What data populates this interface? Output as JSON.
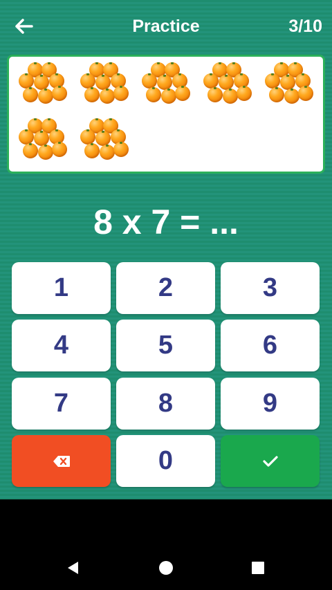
{
  "header": {
    "title": "Practice",
    "progress": "3/10"
  },
  "question": {
    "equation": "8 x 7 = ..."
  },
  "illustration": {
    "group_count": 7,
    "items_per_group": 8,
    "item_icon": "orange-icon"
  },
  "keypad": {
    "keys": [
      "1",
      "2",
      "3",
      "4",
      "5",
      "6",
      "7",
      "8",
      "9",
      "",
      "0",
      ""
    ],
    "delete_icon": "backspace-icon",
    "confirm_icon": "checkmark-icon"
  },
  "colors": {
    "background": "#1e8d6f",
    "card_border": "#2bb05a",
    "key_text": "#333a85",
    "delete": "#f14e23",
    "confirm": "#1aa84d"
  },
  "system_nav": {
    "icons": [
      "back-triangle-icon",
      "home-circle-icon",
      "recents-square-icon"
    ]
  }
}
